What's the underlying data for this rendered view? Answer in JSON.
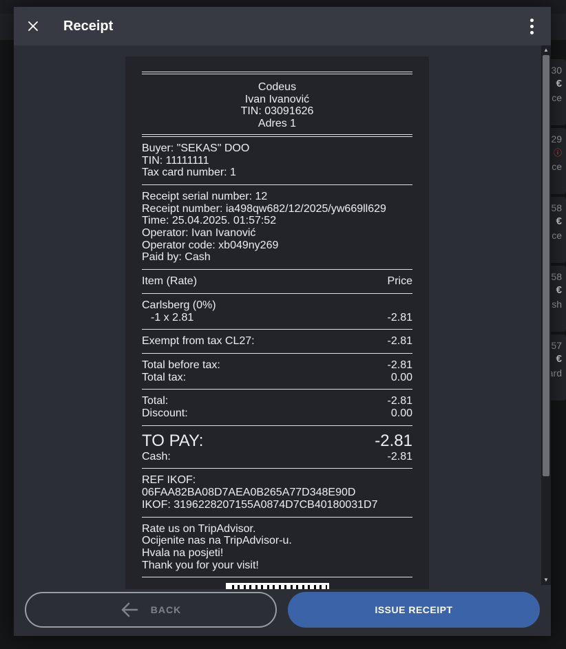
{
  "background": {
    "cards": [
      {
        "amount": "30",
        "currency": "€",
        "label": "ce"
      },
      {
        "amount": "29",
        "currency": "ⓘ",
        "label": "ce"
      },
      {
        "amount": "58",
        "currency": "€",
        "label": "ce"
      },
      {
        "amount": "58",
        "currency": "€",
        "label": "sh"
      },
      {
        "amount": "57",
        "currency": "€",
        "label": "ard"
      }
    ]
  },
  "dialog": {
    "title": "Receipt",
    "close_icon": "close-icon",
    "menu_icon": "more-vertical-icon"
  },
  "receipt": {
    "company": "Codeus",
    "owner": "Ivan Ivanović",
    "tin": "TIN: 03091626",
    "address": "Adres 1",
    "buyer": "Buyer: \"SEKAS\" DOO",
    "buyer_tin": "TIN: 11111111",
    "tax_card": "Tax card number: 1",
    "serial": "Receipt serial number: 12",
    "number": "Receipt number: ia498qw682/12/2025/yw669ll629",
    "time": "Time: 25.04.2025. 01:57:52",
    "operator": "Operator: Ivan Ivanović",
    "operator_code": "Operator code: xb049ny269",
    "paid_by": "Paid by: Cash",
    "items_header": {
      "left": "Item (Rate)",
      "right": "Price"
    },
    "item_name": "Carlsberg (0%)",
    "item_qty": "-1 x 2.81",
    "item_price": "-2.81",
    "exempt_label": "Exempt from tax CL27:",
    "exempt_value": "-2.81",
    "total_before_tax_label": "Total before tax:",
    "total_before_tax_value": "-2.81",
    "total_tax_label": "Total tax:",
    "total_tax_value": "0.00",
    "total_label": "Total:",
    "total_value": "-2.81",
    "discount_label": "Discount:",
    "discount_value": "0.00",
    "to_pay_label": "TO PAY:",
    "to_pay_value": "-2.81",
    "cash_label": "Cash:",
    "cash_value": "-2.81",
    "ref_ikof": "REF IKOF: 06FAA82BA08D7AEA0B265A77D348E90D",
    "ikof": "IKOF: 3196228207155A0874D7CB40180031D7",
    "footer_lines": [
      "Rate us on TripAdvisor.",
      "Ocijenite nas na TripAdvisor-u.",
      "Hvala na posjeti!",
      "Thank you for your visit!"
    ]
  },
  "buttons": {
    "back": "BACK",
    "issue": "ISSUE RECEIPT"
  },
  "colors": {
    "primary": "#3b64a8",
    "dialog_bg": "#2b2e35",
    "header_bg": "#373a42",
    "receipt_bg": "#22242a"
  }
}
